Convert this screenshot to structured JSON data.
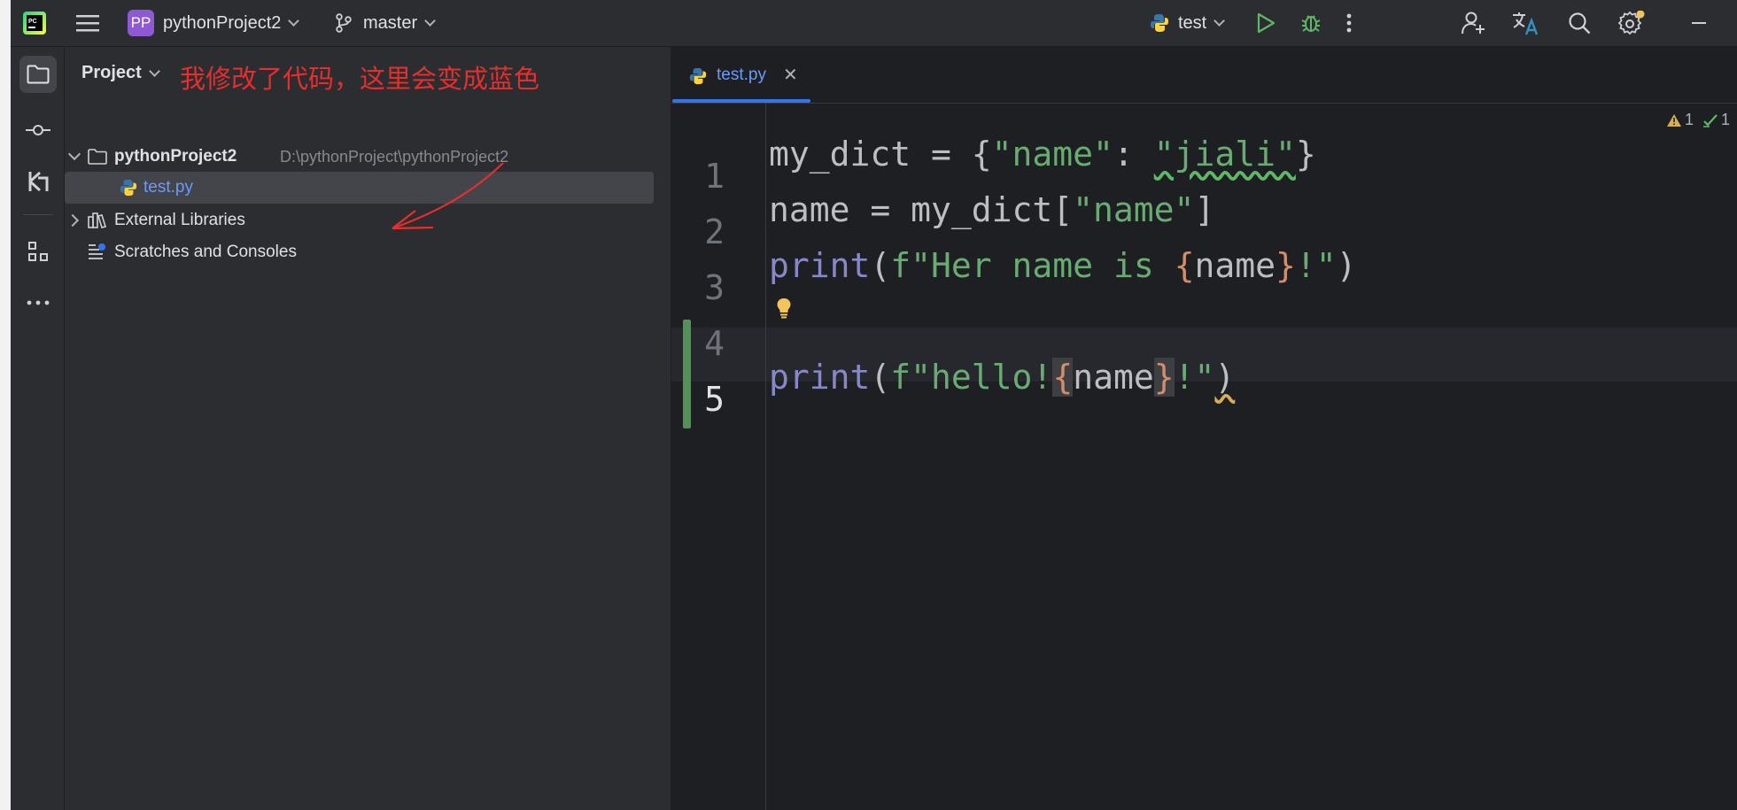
{
  "titlebar": {
    "project_badge": "PP",
    "project_name": "pythonProject2",
    "branch": "master",
    "run_config": "test"
  },
  "project_panel": {
    "title": "Project",
    "annotation": "我修改了代码，这里会变成蓝色",
    "tree": {
      "root_name": "pythonProject2",
      "root_path": "D:\\pythonProject\\pythonProject2",
      "file": "test.py",
      "external": "External Libraries",
      "scratches": "Scratches and Consoles"
    }
  },
  "editor": {
    "tab_label": "test.py",
    "warnings_count": "1",
    "checks_count": "1",
    "line_numbers": [
      "1",
      "2",
      "3",
      "4",
      "5"
    ],
    "lines": {
      "l1": {
        "a": "my_dict = {",
        "b": "\"name\"",
        "c": ": ",
        "d": "\"jiali\"",
        "e": "}"
      },
      "l2": {
        "a": "name = my_dict[",
        "b": "\"name\"",
        "c": "]"
      },
      "l3": {
        "a": "print",
        "b": "(",
        "c": "f\"Her name is ",
        "d": "{",
        "e": "name",
        "f": "}",
        "g": "!\"",
        "h": ")"
      },
      "l5": {
        "a": "print",
        "b": "(",
        "c": "f\"hello!",
        "d": "{",
        "e": "name",
        "f": "}",
        "g": "!\"",
        "h": ")"
      }
    }
  },
  "colors": {
    "accent_blue": "#3574f0",
    "modified_green": "#549159",
    "annotation_red": "#e62e2e"
  }
}
